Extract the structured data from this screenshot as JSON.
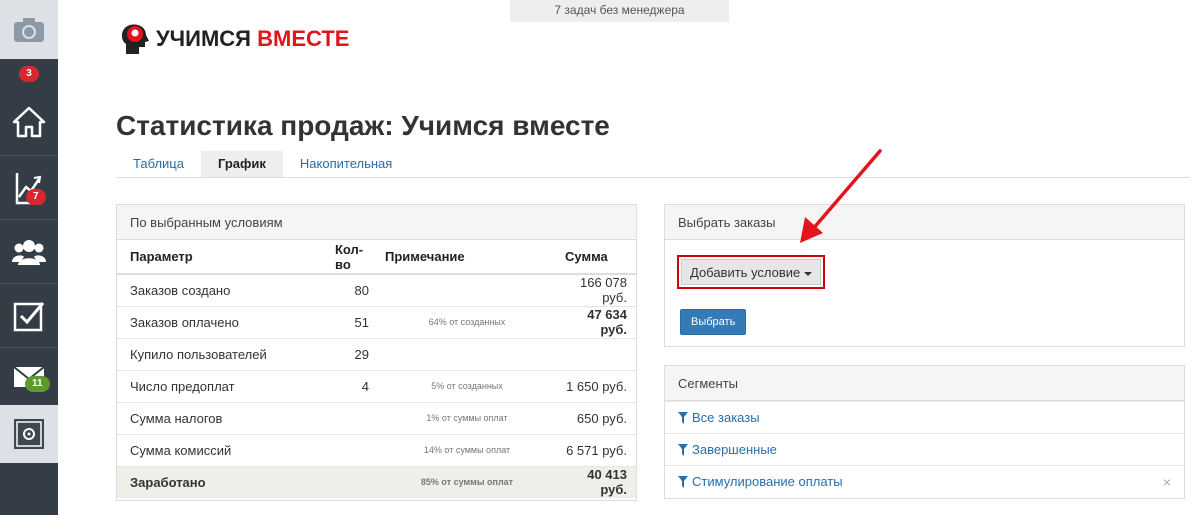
{
  "banner": {
    "text": "7 задач без менеджера"
  },
  "logo": {
    "word1": "УЧИМСЯ",
    "word2": "ВМЕСТЕ"
  },
  "sidebar": {
    "items": [
      {
        "icon": "camera-icon",
        "badge": null
      },
      {
        "icon": "notifications",
        "badge": "3",
        "badge_color": "#d9262f"
      },
      {
        "icon": "home-icon",
        "badge": null
      },
      {
        "icon": "chart-icon",
        "badge": "7",
        "badge_color": "#d9262f"
      },
      {
        "icon": "users-icon",
        "badge": null
      },
      {
        "icon": "checkbox-icon",
        "badge": null
      },
      {
        "icon": "mail-icon",
        "badge": "11",
        "badge_color": "#5c9a2b"
      },
      {
        "icon": "safe-icon",
        "badge": null
      }
    ]
  },
  "page": {
    "title": "Статистика продаж: Учимся вместе"
  },
  "tabs": [
    {
      "label": "Таблица",
      "active": false
    },
    {
      "label": "График",
      "active": true
    },
    {
      "label": "Накопительная",
      "active": false
    }
  ],
  "stats": {
    "heading": "По выбранным условиям",
    "columns": {
      "param": "Параметр",
      "qty": "Кол-во",
      "note": "Примечание",
      "sum": "Сумма"
    },
    "rows": [
      {
        "param": "Заказов создано",
        "qty": "80",
        "note": "",
        "sum": "166 078 руб."
      },
      {
        "param": "Заказов оплачено",
        "qty": "51",
        "note": "64% от созданных",
        "sum": "47 634 руб."
      },
      {
        "param": "Купило пользователей",
        "qty": "29",
        "note": "",
        "sum": ""
      },
      {
        "param": "Число предоплат",
        "qty": "4",
        "note": "5% от созданных",
        "sum": "1 650 руб."
      },
      {
        "param": "Сумма налогов",
        "qty": "",
        "note": "1% от суммы оплат",
        "sum": "650 руб."
      },
      {
        "param": "Сумма комиссий",
        "qty": "",
        "note": "14% от суммы оплат",
        "sum": "6 571 руб."
      }
    ],
    "total": {
      "param": "Заработано",
      "qty": "",
      "note": "85% от суммы оплат",
      "sum": "40 413 руб."
    }
  },
  "orders": {
    "heading": "Выбрать заказы",
    "add_condition_label": "Добавить условие",
    "select_label": "Выбрать"
  },
  "segments": {
    "heading": "Сегменты",
    "items": [
      "Все заказы",
      "Завершенные",
      "Стимулирование оплаты"
    ],
    "close_glyph": "×"
  },
  "colors": {
    "sidebar": "#343d46",
    "link": "#2a6ea6",
    "brand_red": "#e2141d",
    "button_blue": "#337ab7"
  }
}
